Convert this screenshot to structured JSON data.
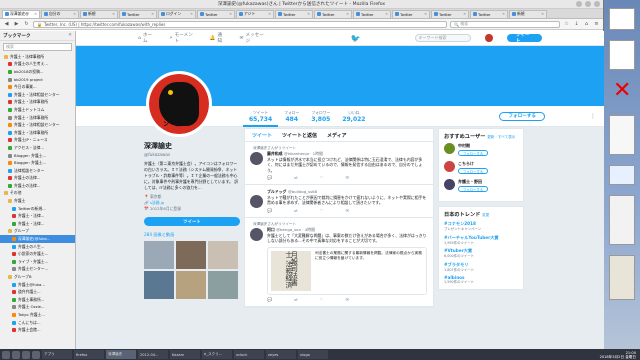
{
  "window": {
    "title": "深澤諭史(@fukazawas)さん | Twitterから送信されたツイート - Mozilla Firefox"
  },
  "tabs": [
    {
      "label": "深澤諭史@"
    },
    {
      "label": "自分の"
    },
    {
      "label": "新規"
    },
    {
      "label": "Twitter"
    },
    {
      "label": "ログイン"
    },
    {
      "label": "Twitter"
    },
    {
      "label": "アジト"
    },
    {
      "label": "Twitter"
    },
    {
      "label": "Twitter"
    },
    {
      "label": "Twitter"
    },
    {
      "label": "Twitter"
    },
    {
      "label": "Twitter"
    },
    {
      "label": "Twitter"
    },
    {
      "label": "新規"
    }
  ],
  "navbar": {
    "url": "Twitter, Inc. (US) | https://twitter.com/fukazawas/with_replies",
    "search_placeholder": "検索"
  },
  "sidebar": {
    "title": "ブックマーク",
    "search_placeholder": "検索",
    "items": [
      {
        "label": "弁護士・法律事務所",
        "kind": "folder",
        "level": 0
      },
      {
        "label": "弁護士の人生考え...",
        "kind": "link",
        "level": 1
      },
      {
        "label": "bb2018の投稿...",
        "kind": "link",
        "level": 1
      },
      {
        "label": "bb2019 project",
        "kind": "link",
        "level": 1
      },
      {
        "label": "今日の事業...",
        "kind": "link",
        "level": 1
      },
      {
        "label": "弁護士・法律相談センター",
        "kind": "link",
        "level": 1
      },
      {
        "label": "弁護士・法律事務所",
        "kind": "link",
        "level": 1
      },
      {
        "label": "弁護士ドットコム",
        "kind": "link",
        "level": 1
      },
      {
        "label": "弁護士・法律事務所",
        "kind": "link",
        "level": 1
      },
      {
        "label": "弁護士・法律相談センター",
        "kind": "link",
        "level": 1
      },
      {
        "label": "弁護士・法律事務所",
        "kind": "link",
        "level": 1
      },
      {
        "label": "弁護士JP・ニュース",
        "kind": "link",
        "level": 1
      },
      {
        "label": "アクセス・法律...",
        "kind": "link",
        "level": 1
      },
      {
        "label": "Blogger: 弁護士...",
        "kind": "link",
        "level": 1
      },
      {
        "label": "Blogger: 弁護士...",
        "kind": "link",
        "level": 1
      },
      {
        "label": "法律相談センター",
        "kind": "link",
        "level": 1
      },
      {
        "label": "弁護士の法律...",
        "kind": "link",
        "level": 1
      },
      {
        "label": "弁護士の法律...",
        "kind": "link",
        "level": 1
      },
      {
        "label": "その他",
        "kind": "folder",
        "level": 0
      },
      {
        "label": "弁護士",
        "kind": "folder",
        "level": 1
      },
      {
        "label": "Twitterの新規...",
        "kind": "link",
        "level": 2
      },
      {
        "label": "弁護士・法律...",
        "kind": "link",
        "level": 2
      },
      {
        "label": "弁護士・法律...",
        "kind": "link",
        "level": 2
      },
      {
        "label": "グループ",
        "kind": "folder",
        "level": 1
      },
      {
        "label": "深澤諭史(@fuka...",
        "kind": "link",
        "level": 2,
        "selected": true
      },
      {
        "label": "弁護士の人生...",
        "kind": "link",
        "level": 2
      },
      {
        "label": "小説家の弁護士...",
        "kind": "link",
        "level": 2
      },
      {
        "label": "ライブ・弁護士...",
        "kind": "link",
        "level": 2
      },
      {
        "label": "弁護士センター...",
        "kind": "link",
        "level": 2
      },
      {
        "label": "グループB",
        "kind": "folder",
        "level": 1
      },
      {
        "label": "弁護士@fuka...",
        "kind": "link",
        "level": 2
      },
      {
        "label": "道弁弁護士...",
        "kind": "link",
        "level": 2
      },
      {
        "label": "弁護士事務所...",
        "kind": "link",
        "level": 2
      },
      {
        "label": "弁護士 Ozzie...",
        "kind": "link",
        "level": 2
      },
      {
        "label": "Tokyo 弁護士...",
        "kind": "link",
        "level": 2
      },
      {
        "label": "こんにちは...",
        "kind": "link",
        "level": 2
      },
      {
        "label": "弁護士会館...",
        "kind": "link",
        "level": 2
      }
    ]
  },
  "twitter_nav": {
    "home": "ホーム",
    "moments": "モーメント",
    "notifications": "通知",
    "messages": "メッセージ",
    "search_placeholder": "キーワード検索",
    "tweet_button": "ツイート"
  },
  "profile": {
    "name": "深澤諭史",
    "handle": "@fukazawas",
    "bio": "弁護士（第二東京弁護士会）。アイコンはフォロワーの白いカラス。ＩＴ法務（システム開発紛争、ネットトラブル・詐欺事件等）。ＩＴ企業の一般法務も中心に。対象事件や刑事弁護を専門分野としています。 訳しては、IT法務に多くの協力を...",
    "location": "東京都",
    "link": "s法務.jp",
    "joined": "2012年6月に登録",
    "tweet_to": "ツイート",
    "photos_label": "284 画像と動画",
    "avatar_text": "ン・ゴン"
  },
  "stats": [
    {
      "label": "ツイート",
      "value": "65,734"
    },
    {
      "label": "フォロー",
      "value": "484"
    },
    {
      "label": "フォロワー",
      "value": "3,805"
    },
    {
      "label": "いいね",
      "value": "29,022"
    }
  ],
  "follow_button": "フォローする",
  "timeline_tabs": [
    {
      "label": "ツイート"
    },
    {
      "label": "ツイートと返信"
    },
    {
      "label": "メディア"
    }
  ],
  "tweets": [
    {
      "context": "深澤諭史さんがリツイート",
      "name": "藤井和成",
      "handle": "@kikanhenjo · 1時間",
      "text": "ネットは情報が洪水で本当に役立つけれど、法律関係は特に玉石混淆で、法律も内容が多く、何にはまだ弁護士が認めているので、情報を発信する自由はあるので、自分のでしょう。"
    },
    {
      "context": "",
      "name": "ブルドッグ",
      "handle": "@bulldog_ss68",
      "text": "ネットで騒がれたことが原因で裁判に損害をかけて疲れないように、ネットや実際に相手を責める事を求めず、法律関係者さんにより相談して頂きたいです。"
    },
    {
      "context": "深澤諭史さんがリツイート",
      "name": "阿口",
      "handle": "@bengo_san · 4時間",
      "text": "弁護士として「大変難解な問題」は、事案の数だけ答えがある場合が多く、法律がはっきりしない部分もある...その中で真摯な対応をすることが大切です。",
      "quote_title": "月報司法書士 法務経済",
      "quote_text": "司法書士の業務に関する最新情報を掲載。法律家の視点から実務に役立つ情報を届けています。"
    }
  ],
  "who_to_follow": {
    "title": "おすすめユーザー",
    "links": "更新 · すべて表示",
    "users": [
      {
        "name": "中村剛"
      },
      {
        "name": "こちらけ"
      },
      {
        "name": "弁護士・野田"
      }
    ],
    "follow_label": "フォローする"
  },
  "trends": {
    "title": "日本のトレンド",
    "links": "変更",
    "items": [
      {
        "tag": "#コナモン2018",
        "desc": "プレゼントキャンペーン"
      },
      {
        "tag": "#バーチャルYouTuber大賞",
        "desc": "1,955件のツイート"
      },
      {
        "tag": "#Vtuber大賞",
        "desc": "6,000件のツイート"
      },
      {
        "tag": "#ブラタモリ",
        "desc": "1,807件のツイート"
      },
      {
        "tag": "#albinos",
        "desc": "1,590件のツイート"
      }
    ]
  },
  "taskbar": {
    "tasks": [
      {
        "label": "アプリ"
      },
      {
        "label": "firefox"
      },
      {
        "label": "深澤諭史"
      },
      {
        "label": "2012-04..."
      },
      {
        "label": "Kazam"
      },
      {
        "label": "e_スクリ..."
      },
      {
        "label": "xclock"
      },
      {
        "label": "zeyes"
      },
      {
        "label": "xlogo"
      }
    ],
    "time": "21:00",
    "date": "2018年3月2日 金曜日"
  },
  "colors": {
    "twitter_blue": "#1da1f2",
    "avatar_red": "#d62d20"
  }
}
